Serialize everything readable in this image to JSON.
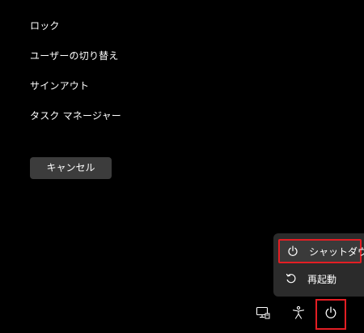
{
  "menu": {
    "lock": "ロック",
    "switch_user": "ユーザーの切り替え",
    "sign_out": "サインアウト",
    "task_manager": "タスク マネージャー"
  },
  "cancel_label": "キャンセル",
  "power_menu": {
    "shutdown": "シャットダウン",
    "restart": "再起動"
  },
  "bottom_icons": [
    "network-icon",
    "accessibility-icon",
    "power-icon"
  ],
  "colors": {
    "background": "#000000",
    "button_bg": "#3c3c3c",
    "flyout_bg": "#2b2b2b",
    "highlight": "#e31e24"
  }
}
